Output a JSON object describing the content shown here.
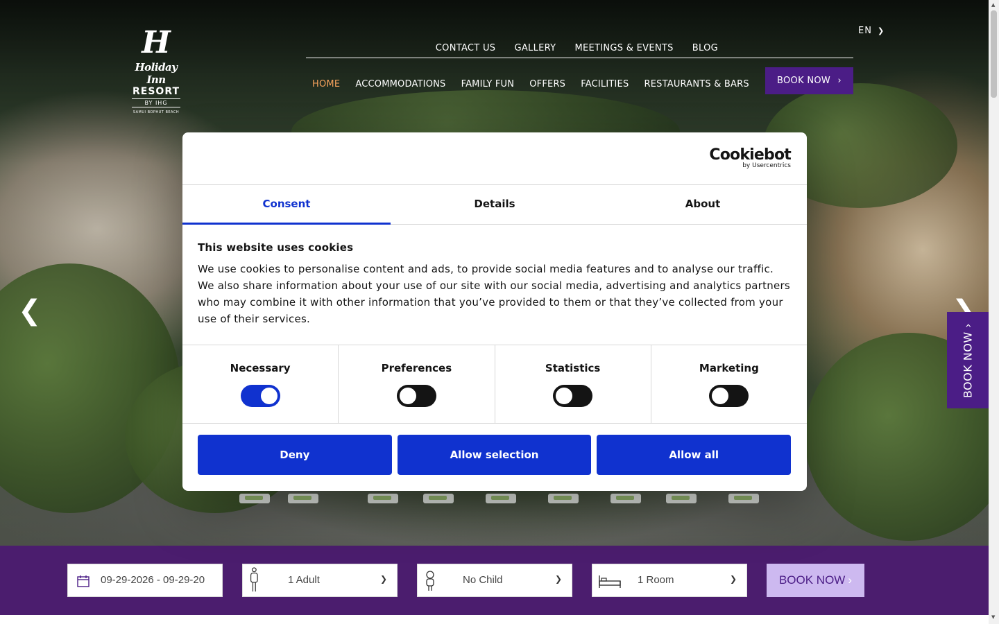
{
  "header": {
    "logo": {
      "line1": "Holiday Inn",
      "line2": "RESORT",
      "line3": "BY IHG",
      "line4": "SAMUI BOPHUT BEACH"
    },
    "top_links": [
      "CONTACT US",
      "GALLERY",
      "MEETINGS & EVENTS",
      "BLOG"
    ],
    "language": "EN",
    "main_nav": [
      "HOME",
      "ACCOMMODATIONS",
      "FAMILY FUN",
      "OFFERS",
      "FACILITIES",
      "RESTAURANTS & BARS"
    ],
    "book_now": "BOOK NOW"
  },
  "side_book": "BOOK NOW",
  "booking_bar": {
    "dates": "09-29-2026 - 09-29-20",
    "adults": "1 Adult",
    "children": "No Child",
    "rooms": "1 Room",
    "book_now": "BOOK NOW"
  },
  "cookie_dialog": {
    "brand": "Cookiebot",
    "brand_sub": "by Usercentrics",
    "tabs": [
      "Consent",
      "Details",
      "About"
    ],
    "active_tab": "Consent",
    "title": "This website uses cookies",
    "text": "We use cookies to personalise content and ads, to provide social media features and to analyse our traffic. We also share information about your use of our site with our social media, advertising and analytics partners who may combine it with other information that you’ve provided to them or that they’ve collected from your use of their services.",
    "categories": [
      {
        "label": "Necessary",
        "enabled": true
      },
      {
        "label": "Preferences",
        "enabled": false
      },
      {
        "label": "Statistics",
        "enabled": false
      },
      {
        "label": "Marketing",
        "enabled": false
      }
    ],
    "buttons": {
      "deny": "Deny",
      "allow_selection": "Allow selection",
      "allow_all": "Allow all"
    },
    "accent_color": "#1032cf"
  },
  "colors": {
    "brand_purple": "#4b1d86",
    "bar_purple": "#4b1d6e",
    "active_nav": "#f7a35c"
  }
}
